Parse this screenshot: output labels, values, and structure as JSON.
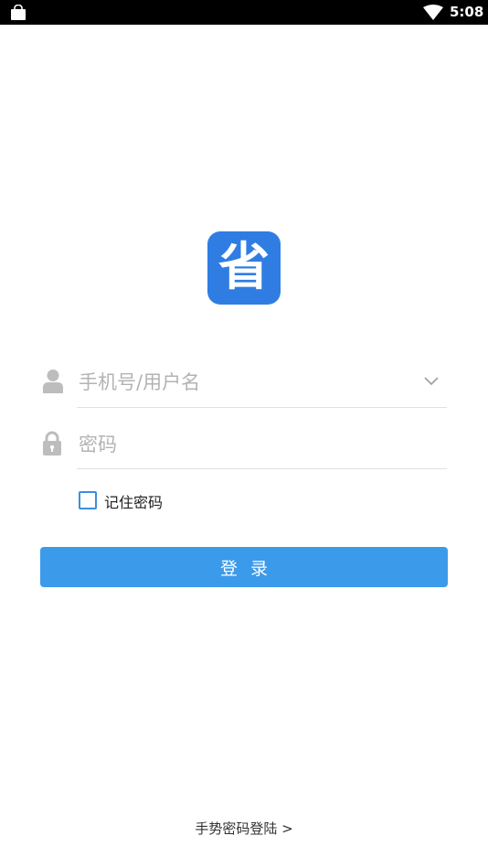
{
  "status_bar": {
    "time": "5:08",
    "icons": [
      "shopping-bag-icon",
      "wifi-icon"
    ]
  },
  "logo": {
    "text": "省",
    "color": "#2f7de3"
  },
  "login_form": {
    "username_placeholder": "手机号/用户名",
    "username_value": "",
    "password_placeholder": "密码",
    "password_value": "",
    "remember_label": "记住密码",
    "remember_checked": false,
    "login_button_label": "登录",
    "accent_color": "#3c9aea"
  },
  "footer": {
    "gesture_login_label": "手势密码登陆 >"
  }
}
